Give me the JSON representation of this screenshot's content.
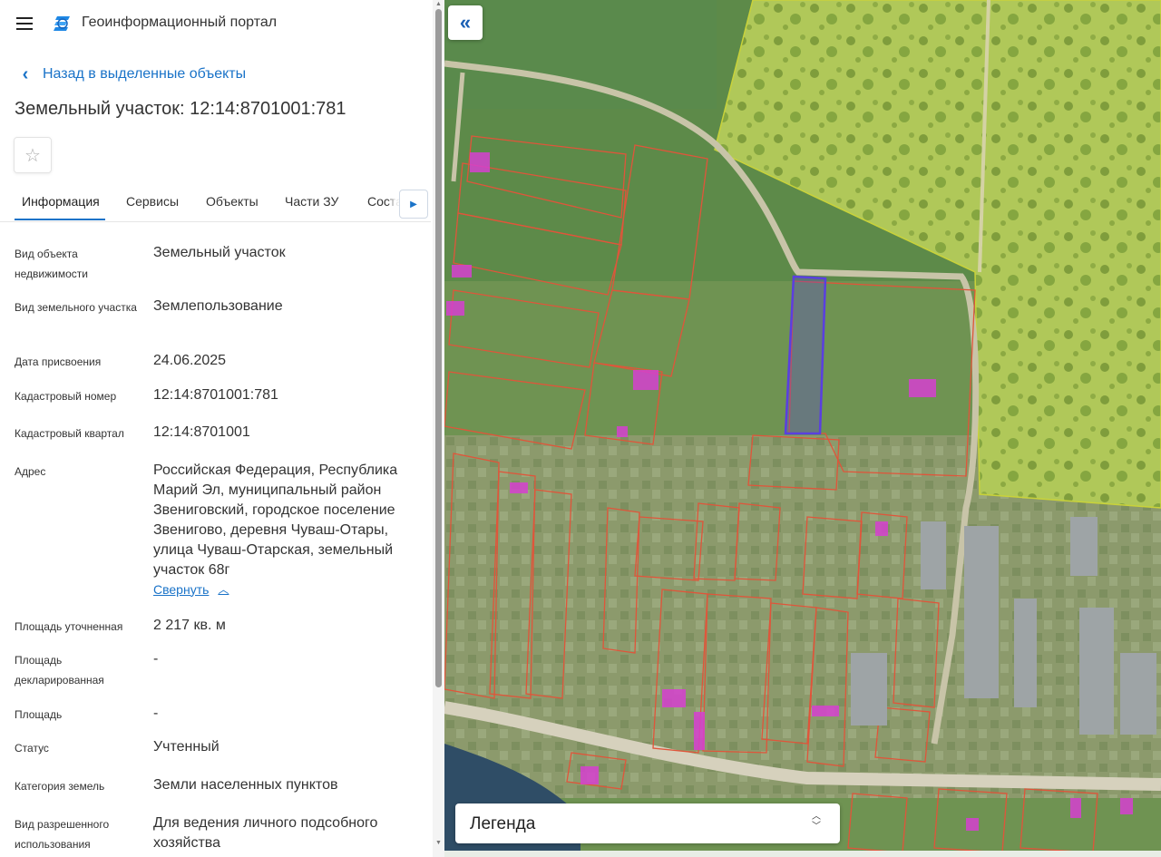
{
  "header": {
    "app_title": "Геоинформационный портал"
  },
  "nav": {
    "back_label": "Назад в выделенные объекты"
  },
  "object": {
    "title": "Земельный участок: 12:14:8701001:781"
  },
  "tabs": [
    {
      "label": "Информация",
      "active": true
    },
    {
      "label": "Сервисы"
    },
    {
      "label": "Объекты"
    },
    {
      "label": "Части ЗУ"
    },
    {
      "label": "Состав"
    }
  ],
  "info": {
    "object_type": {
      "label": "Вид объекта недвижимости",
      "value": "Земельный участок"
    },
    "parcel_type": {
      "label": "Вид земельного участка",
      "value": "Землепользование"
    },
    "assign_date": {
      "label": "Дата присвоения",
      "value": "24.06.2025"
    },
    "cadastral_number": {
      "label": "Кадастровый номер",
      "value": "12:14:8701001:781"
    },
    "cadastral_quarter": {
      "label": "Кадастровый квартал",
      "value": "12:14:8701001"
    },
    "address": {
      "label": "Адрес",
      "value": "Российская Федерация, Республика Марий Эл, муниципальный район Звениговский, городское поселение Звенигово, деревня Чуваш-Отары, улица Чуваш-Отарская, земельный участок 68г",
      "collapse_label": "Свернуть"
    },
    "area_specified": {
      "label": "Площадь уточненная",
      "value": "2 217 кв. м"
    },
    "area_declared": {
      "label": "Площадь декларированная",
      "value": "-"
    },
    "area": {
      "label": "Площадь",
      "value": "-"
    },
    "status": {
      "label": "Статус",
      "value": "Учтенный"
    },
    "land_category": {
      "label": "Категория земель",
      "value": "Земли населенных пунктов"
    },
    "permitted_use": {
      "label": "Вид разрешенного использования",
      "value": "Для ведения личного подсобного хозяйства"
    }
  },
  "map": {
    "legend_label": "Легенда",
    "colors": {
      "parcel_border": "#e0553a",
      "selected_parcel": "#5a3fe0",
      "building": "#d63fd0",
      "forest_zone": "#d8e85a",
      "accent": "#1a73c8"
    }
  }
}
